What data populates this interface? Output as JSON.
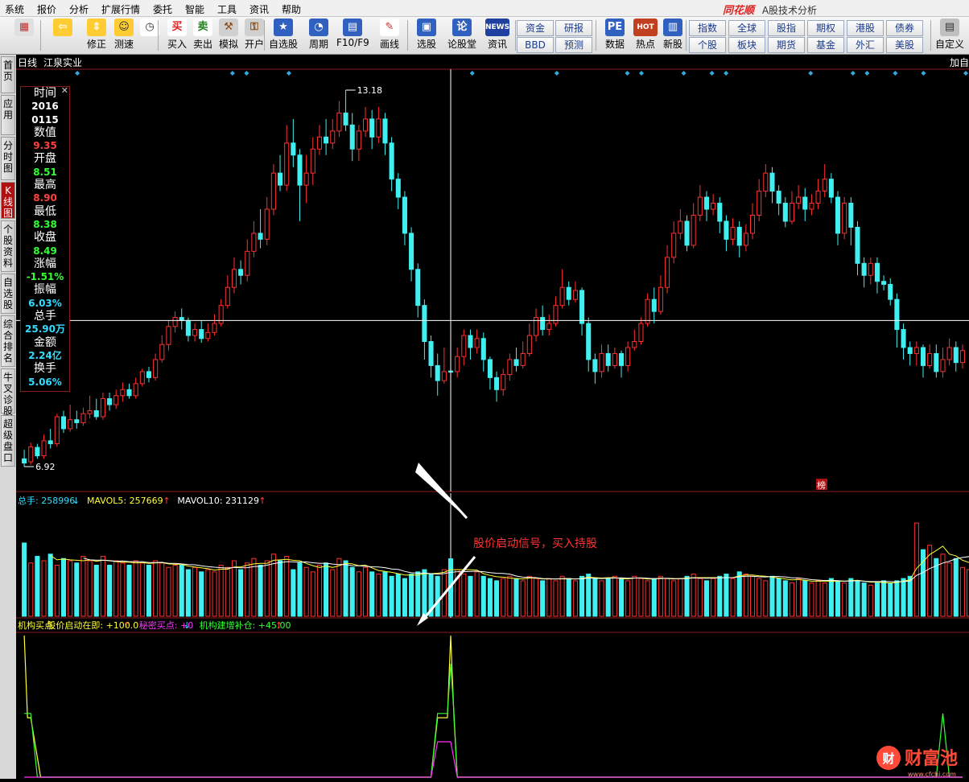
{
  "menu": [
    "系统",
    "报价",
    "分析",
    "扩展行情",
    "委托",
    "智能",
    "工具",
    "资讯",
    "帮助"
  ],
  "app_title": {
    "logo": "同花顺",
    "subtitle": "A股技术分析"
  },
  "toolbar": {
    "buttons": [
      {
        "label": "",
        "icon": "grid-icon"
      },
      {
        "label": "",
        "icon": "back-arrow-icon"
      },
      {
        "label": "修正",
        "icon": "up-down-arrow-icon"
      },
      {
        "label": "测速",
        "icon": "smile-icon"
      },
      {
        "label": "",
        "icon": "clock-icon"
      },
      {
        "label": "买入",
        "icon": "buy-icon",
        "glyph": "买"
      },
      {
        "label": "卖出",
        "icon": "sell-icon",
        "glyph": "卖"
      },
      {
        "label": "模拟",
        "icon": "hammer-icon"
      },
      {
        "label": "开户",
        "icon": "lock-icon"
      },
      {
        "label": "自选股",
        "icon": "star-icon"
      },
      {
        "label": "周期",
        "icon": "cycle-icon"
      },
      {
        "label": "F10/F9",
        "icon": "f10-icon"
      },
      {
        "label": "画线",
        "icon": "pen-icon"
      },
      {
        "label": "选股",
        "icon": "screen-icon"
      },
      {
        "label": "论股堂",
        "icon": "discuss-icon",
        "glyph": "论"
      },
      {
        "label": "资讯",
        "icon": "news-icon",
        "glyph": "NEWS"
      },
      {
        "label": "数据",
        "icon": "pe-icon",
        "glyph": "PE"
      },
      {
        "label": "热点",
        "icon": "hot-icon",
        "glyph": "HOT"
      },
      {
        "label": "新股",
        "icon": "new-stock-icon"
      },
      {
        "label": "自定义",
        "icon": "custom-icon"
      }
    ],
    "small_buttons_a": [
      "资金",
      "研报",
      "BBD",
      "预测"
    ],
    "small_buttons_b": [
      "指数",
      "全球",
      "股指",
      "期权",
      "港股",
      "债券",
      "个股",
      "板块",
      "期货",
      "基金",
      "外汇",
      "美股"
    ]
  },
  "left_tabs": [
    "首页",
    "应用",
    "分时图",
    "K线图",
    "个股资料",
    "自选股",
    "综合排名",
    "牛叉诊股",
    "超级盘口"
  ],
  "chart_header": {
    "period": "日线",
    "stock": "江泉实业",
    "right_label": "加自"
  },
  "info_panel": {
    "items": [
      {
        "key": "时间",
        "value": "2016\n0115",
        "color": "#ffffff"
      },
      {
        "key": "数值",
        "value": "9.35",
        "color": "#ff4040"
      },
      {
        "key": "开盘",
        "value": "8.51",
        "color": "#33ff33"
      },
      {
        "key": "最高",
        "value": "8.90",
        "color": "#ff4040"
      },
      {
        "key": "最低",
        "value": "8.38",
        "color": "#33ff33"
      },
      {
        "key": "收盘",
        "value": "8.49",
        "color": "#33ff33"
      },
      {
        "key": "涨幅",
        "value": "-1.51%",
        "color": "#33ff33"
      },
      {
        "key": "振幅",
        "value": "6.03%",
        "color": "#33ddff"
      },
      {
        "key": "总手",
        "value": "25.90万",
        "color": "#33ddff"
      },
      {
        "key": "金额",
        "value": "2.24亿",
        "color": "#33ddff"
      },
      {
        "key": "换手",
        "value": "5.06%",
        "color": "#33ddff"
      }
    ]
  },
  "price_labels": {
    "high": "13.18",
    "low": "6.92"
  },
  "rank_badge": "榜",
  "volume_header": [
    {
      "text": "总手: 258996",
      "arrow": "↓",
      "color": "#33ddff",
      "arrow_color": "#33ddff"
    },
    {
      "text": "MAVOL5: 257669",
      "arrow": "↑",
      "color": "#ffff33",
      "arrow_color": "#ff4040"
    },
    {
      "text": "MAVOL10: 231129",
      "arrow": "↑",
      "color": "#ffffff",
      "arrow_color": "#ff4040"
    }
  ],
  "indicator_header": [
    {
      "text": "机构买点",
      "color": "#ffff33",
      "arrow": "",
      "arrow_color": ""
    },
    {
      "text": "股价启动在即: +100.0",
      "color": "#ffff33",
      "arrow": "↑",
      "arrow_color": "#ff4040"
    },
    {
      "text": "秘密买点: +0",
      "color": "#ff33ff",
      "arrow": "↓",
      "arrow_color": "#33ddff"
    },
    {
      "text": "机构建增补仓: +45.00",
      "color": "#33ff33",
      "arrow": "↑",
      "arrow_color": "#ff4040"
    }
  ],
  "annotation": "股价启动信号，买入持股",
  "watermark": {
    "brand": "财富池",
    "url": "www.cfchi.com"
  },
  "colors": {
    "up": "#ff3030",
    "down": "#40f0f0",
    "bg": "#000000",
    "axis": "#8a1a1a",
    "ma5": "#ffff33",
    "ma10": "#ffffff"
  },
  "chart_data": {
    "type": "candlestick",
    "selected_date": "2016-01-15",
    "price_range": [
      6.92,
      13.18
    ],
    "candles": [
      [
        7.05,
        6.98,
        7.2,
        6.92
      ],
      [
        7.0,
        7.25,
        7.32,
        6.95
      ],
      [
        7.24,
        7.1,
        7.3,
        7.05
      ],
      [
        7.1,
        7.35,
        7.45,
        7.05
      ],
      [
        7.35,
        7.3,
        7.55,
        7.22
      ],
      [
        7.3,
        7.75,
        7.8,
        7.25
      ],
      [
        7.75,
        7.55,
        7.85,
        7.48
      ],
      [
        7.55,
        7.7,
        7.95,
        7.5
      ],
      [
        7.7,
        7.65,
        7.85,
        7.55
      ],
      [
        7.65,
        7.8,
        7.9,
        7.6
      ],
      [
        7.8,
        7.85,
        8.1,
        7.72
      ],
      [
        7.85,
        7.75,
        8.05,
        7.7
      ],
      [
        7.75,
        8.05,
        8.15,
        7.7
      ],
      [
        8.05,
        7.95,
        8.15,
        7.85
      ],
      [
        7.95,
        8.1,
        8.2,
        7.88
      ],
      [
        8.1,
        8.2,
        8.32,
        8.0
      ],
      [
        8.2,
        8.1,
        8.3,
        8.05
      ],
      [
        8.1,
        8.3,
        8.4,
        8.05
      ],
      [
        8.3,
        8.5,
        8.55,
        8.25
      ],
      [
        8.5,
        8.4,
        8.58,
        8.32
      ],
      [
        8.4,
        8.7,
        8.8,
        8.35
      ],
      [
        8.7,
        8.95,
        9.1,
        8.65
      ],
      [
        8.95,
        9.25,
        9.35,
        8.85
      ],
      [
        9.25,
        9.4,
        9.5,
        9.15
      ],
      [
        9.4,
        9.35,
        9.55,
        9.2
      ],
      [
        9.35,
        9.1,
        9.4,
        9.0
      ],
      [
        9.1,
        9.2,
        9.3,
        9.0
      ],
      [
        9.2,
        9.05,
        9.35,
        8.98
      ],
      [
        9.05,
        9.15,
        9.3,
        9.0
      ],
      [
        9.15,
        9.3,
        9.45,
        9.1
      ],
      [
        9.3,
        9.6,
        9.7,
        9.25
      ],
      [
        9.6,
        9.9,
        10.1,
        9.55
      ],
      [
        9.9,
        10.2,
        10.4,
        9.8
      ],
      [
        10.2,
        10.1,
        10.35,
        9.95
      ],
      [
        10.1,
        10.5,
        10.7,
        10.0
      ],
      [
        10.5,
        10.8,
        11.0,
        10.4
      ],
      [
        10.8,
        10.7,
        11.2,
        10.55
      ],
      [
        10.7,
        11.2,
        11.4,
        10.6
      ],
      [
        11.2,
        11.8,
        11.95,
        11.1
      ],
      [
        11.8,
        11.6,
        12.1,
        11.5
      ],
      [
        11.6,
        12.3,
        12.6,
        11.5
      ],
      [
        12.3,
        12.1,
        12.7,
        11.9
      ],
      [
        12.1,
        11.6,
        12.2,
        11.0
      ],
      [
        11.6,
        11.8,
        12.1,
        11.3
      ],
      [
        11.8,
        12.2,
        12.4,
        11.6
      ],
      [
        12.2,
        12.4,
        12.6,
        12.1
      ],
      [
        12.4,
        12.3,
        12.7,
        12.1
      ],
      [
        12.3,
        12.5,
        12.7,
        12.2
      ],
      [
        12.5,
        12.8,
        13.0,
        12.4
      ],
      [
        12.8,
        12.6,
        13.18,
        12.5
      ],
      [
        12.6,
        12.2,
        12.8,
        12.0
      ],
      [
        12.2,
        12.5,
        12.6,
        12.0
      ],
      [
        12.5,
        12.7,
        12.9,
        12.4
      ],
      [
        12.7,
        12.4,
        12.85,
        12.2
      ],
      [
        12.4,
        12.7,
        12.9,
        12.3
      ],
      [
        12.7,
        12.3,
        12.8,
        12.1
      ],
      [
        12.3,
        11.7,
        12.4,
        11.5
      ],
      [
        11.7,
        11.4,
        11.8,
        11.2
      ],
      [
        11.4,
        10.8,
        11.5,
        10.6
      ],
      [
        10.8,
        10.2,
        10.9,
        10.0
      ],
      [
        10.2,
        9.6,
        10.3,
        9.4
      ],
      [
        9.6,
        9.0,
        9.7,
        8.7
      ],
      [
        9.0,
        8.6,
        9.1,
        8.4
      ],
      [
        8.6,
        8.35,
        8.8,
        8.1
      ],
      [
        8.35,
        8.5,
        8.9,
        8.3
      ],
      [
        8.51,
        8.49,
        8.9,
        8.38
      ],
      [
        8.5,
        8.75,
        8.9,
        8.4
      ],
      [
        8.75,
        9.1,
        9.2,
        8.6
      ],
      [
        9.1,
        8.9,
        9.2,
        8.7
      ],
      [
        8.9,
        9.05,
        9.2,
        8.8
      ],
      [
        9.05,
        8.7,
        9.15,
        8.5
      ],
      [
        8.7,
        8.4,
        8.75,
        8.2
      ],
      [
        8.4,
        8.2,
        8.5,
        8.0
      ],
      [
        8.2,
        8.45,
        8.55,
        8.1
      ],
      [
        8.45,
        8.7,
        8.8,
        8.35
      ],
      [
        8.7,
        8.6,
        8.9,
        8.5
      ],
      [
        8.6,
        8.8,
        9.0,
        8.55
      ],
      [
        8.8,
        9.1,
        9.3,
        8.75
      ],
      [
        9.1,
        9.4,
        9.55,
        9.0
      ],
      [
        9.4,
        9.2,
        9.6,
        9.1
      ],
      [
        9.2,
        9.3,
        9.45,
        9.1
      ],
      [
        9.3,
        9.6,
        9.75,
        9.25
      ],
      [
        9.6,
        9.9,
        10.2,
        9.55
      ],
      [
        9.9,
        9.7,
        10.0,
        9.6
      ],
      [
        9.7,
        9.85,
        10.0,
        9.65
      ],
      [
        9.85,
        9.3,
        9.9,
        9.1
      ],
      [
        9.3,
        8.7,
        9.4,
        8.5
      ],
      [
        8.7,
        8.5,
        8.8,
        8.3
      ],
      [
        8.5,
        8.8,
        8.95,
        8.4
      ],
      [
        8.8,
        8.6,
        8.95,
        8.5
      ],
      [
        8.6,
        8.8,
        8.9,
        8.55
      ],
      [
        8.8,
        8.6,
        8.85,
        8.4
      ],
      [
        8.6,
        8.9,
        9.0,
        8.5
      ],
      [
        8.9,
        9.0,
        9.2,
        8.85
      ],
      [
        9.0,
        9.3,
        9.4,
        8.95
      ],
      [
        9.3,
        9.7,
        9.8,
        9.25
      ],
      [
        9.7,
        9.5,
        9.9,
        9.3
      ],
      [
        9.5,
        9.9,
        10.1,
        9.45
      ],
      [
        9.9,
        10.4,
        10.6,
        9.8
      ],
      [
        10.4,
        10.8,
        11.0,
        10.3
      ],
      [
        10.8,
        11.0,
        11.2,
        10.7
      ],
      [
        11.0,
        10.6,
        11.1,
        10.5
      ],
      [
        10.6,
        11.1,
        11.3,
        10.55
      ],
      [
        11.1,
        11.4,
        11.6,
        11.0
      ],
      [
        11.4,
        11.2,
        11.5,
        11.0
      ],
      [
        11.2,
        11.3,
        11.45,
        11.1
      ],
      [
        11.3,
        11.0,
        11.4,
        10.8
      ],
      [
        11.0,
        10.7,
        11.1,
        10.5
      ],
      [
        10.7,
        10.9,
        11.05,
        10.6
      ],
      [
        10.9,
        10.6,
        11.0,
        10.4
      ],
      [
        10.6,
        10.8,
        10.95,
        10.5
      ],
      [
        10.8,
        11.1,
        11.3,
        10.7
      ],
      [
        11.1,
        11.5,
        11.7,
        11.0
      ],
      [
        11.5,
        11.8,
        11.95,
        11.4
      ],
      [
        11.8,
        11.5,
        11.9,
        11.3
      ],
      [
        11.5,
        11.3,
        11.6,
        11.1
      ],
      [
        11.3,
        11.0,
        11.4,
        10.9
      ],
      [
        11.0,
        11.3,
        11.5,
        10.95
      ],
      [
        11.3,
        11.4,
        11.6,
        11.2
      ],
      [
        11.4,
        11.2,
        11.55,
        11.0
      ],
      [
        11.2,
        11.3,
        11.45,
        11.1
      ],
      [
        11.3,
        11.5,
        11.7,
        11.2
      ],
      [
        11.5,
        11.7,
        11.95,
        11.4
      ],
      [
        11.7,
        11.4,
        11.8,
        11.3
      ],
      [
        11.4,
        10.8,
        11.5,
        10.6
      ],
      [
        10.8,
        11.3,
        11.4,
        10.7
      ],
      [
        11.3,
        10.9,
        11.4,
        10.6
      ],
      [
        10.9,
        10.3,
        11.0,
        10.1
      ],
      [
        10.3,
        10.1,
        10.4,
        9.9
      ],
      [
        10.1,
        10.3,
        10.4,
        9.95
      ],
      [
        10.3,
        10.0,
        10.4,
        9.8
      ],
      [
        10.0,
        9.95,
        10.1,
        9.85
      ],
      [
        9.95,
        9.7,
        10.05,
        9.6
      ],
      [
        9.7,
        9.2,
        9.8,
        8.9
      ],
      [
        9.2,
        8.9,
        9.3,
        8.7
      ],
      [
        8.9,
        8.8,
        9.0,
        8.6
      ],
      [
        8.8,
        8.9,
        9.0,
        8.6
      ],
      [
        8.9,
        8.6,
        8.95,
        8.4
      ],
      [
        8.6,
        8.8,
        8.95,
        8.55
      ],
      [
        8.8,
        8.5,
        8.95,
        8.4
      ],
      [
        8.5,
        8.7,
        8.9,
        8.4
      ],
      [
        8.7,
        8.9,
        9.05,
        8.6
      ],
      [
        8.9,
        8.65,
        9.0,
        8.5
      ],
      [
        8.65,
        8.85,
        8.95,
        8.55
      ]
    ],
    "volume_range": [
      0,
      500000
    ],
    "volumes": [
      330000,
      240000,
      270000,
      250000,
      280000,
      230000,
      260000,
      250000,
      240000,
      270000,
      250000,
      230000,
      270000,
      230000,
      250000,
      240000,
      230000,
      250000,
      240000,
      230000,
      250000,
      240000,
      220000,
      230000,
      230000,
      210000,
      220000,
      200000,
      210000,
      200000,
      230000,
      220000,
      250000,
      210000,
      240000,
      260000,
      230000,
      250000,
      280000,
      250000,
      270000,
      210000,
      240000,
      220000,
      200000,
      230000,
      240000,
      210000,
      260000,
      250000,
      220000,
      200000,
      220000,
      200000,
      190000,
      200000,
      180000,
      190000,
      170000,
      190000,
      200000,
      210000,
      190000,
      180000,
      210000,
      258996,
      210000,
      190000,
      180000,
      200000,
      180000,
      170000,
      160000,
      170000,
      180000,
      170000,
      160000,
      180000,
      170000,
      160000,
      170000,
      160000,
      180000,
      170000,
      160000,
      180000,
      190000,
      170000,
      160000,
      170000,
      180000,
      170000,
      160000,
      180000,
      170000,
      160000,
      170000,
      180000,
      170000,
      160000,
      170000,
      180000,
      190000,
      170000,
      160000,
      170000,
      180000,
      190000,
      170000,
      200000,
      190000,
      180000,
      170000,
      160000,
      180000,
      170000,
      160000,
      150000,
      170000,
      160000,
      150000,
      160000,
      150000,
      170000,
      160000,
      150000,
      170000,
      160000,
      150000,
      140000,
      150000,
      160000,
      150000,
      160000,
      170000,
      180000,
      420000,
      300000,
      320000,
      260000,
      280000,
      240000,
      260000,
      220000,
      210000,
      190000,
      180000,
      200000,
      190000,
      180000,
      200000,
      190000,
      180000,
      190000
    ]
  }
}
